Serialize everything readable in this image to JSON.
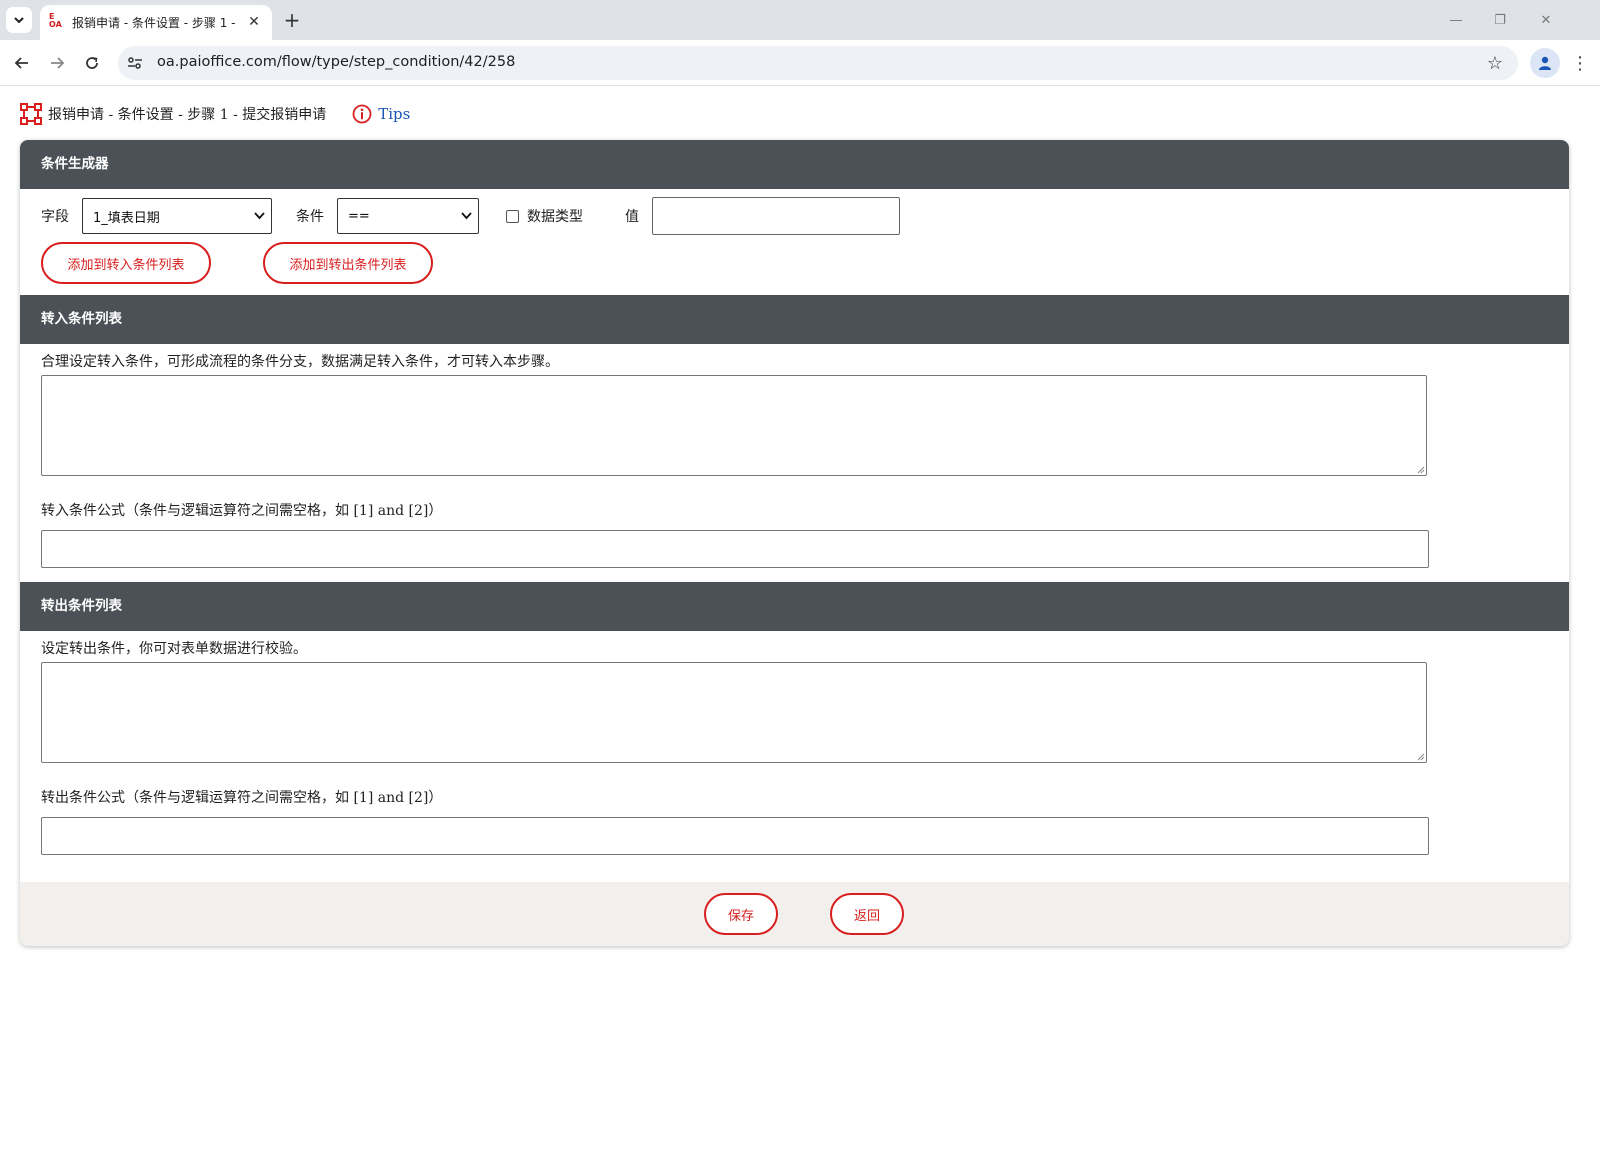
{
  "browser": {
    "tab_title": "报销申请 - 条件设置 - 步骤 1 -",
    "favicon_text": [
      "E",
      "OA"
    ],
    "url": "oa.paioffice.com/flow/type/step_condition/42/258"
  },
  "page": {
    "title": "报销申请 - 条件设置 - 步骤 1 - 提交报销申请",
    "tips_label": "Tips"
  },
  "builder": {
    "header": "条件生成器",
    "field_label": "字段",
    "field_value": "1_填表日期",
    "condition_label": "条件",
    "condition_value": "==",
    "datatype_label": "数据类型",
    "datatype_checked": false,
    "value_label": "值",
    "value_input": "",
    "add_in_label": "添加到转入条件列表",
    "add_out_label": "添加到转出条件列表"
  },
  "in_section": {
    "header": "转入条件列表",
    "help": "合理设定转入条件，可形成流程的条件分支，数据满足转入条件，才可转入本步骤。",
    "list_value": "",
    "formula_label": "转入条件公式（条件与逻辑运算符之间需空格，如 [1] and [2]）",
    "formula_value": ""
  },
  "out_section": {
    "header": "转出条件列表",
    "help": "设定转出条件，你可对表单数据进行校验。",
    "list_value": "",
    "formula_label": "转出条件公式（条件与逻辑运算符之间需空格，如 [1] and [2]）",
    "formula_value": ""
  },
  "footer": {
    "save_label": "保存",
    "back_label": "返回"
  },
  "colors": {
    "accent_red": "#d81e1e",
    "header_bg": "#4b5156",
    "link_blue": "#1a55b6",
    "footer_bg": "#f2efed"
  }
}
